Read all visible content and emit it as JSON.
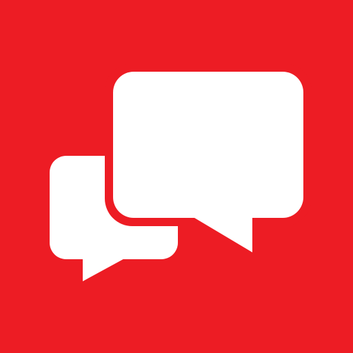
{
  "icon": {
    "name": "chat-bubbles-icon",
    "background_color": "#ed1c24",
    "bubble_color": "#ffffff"
  }
}
